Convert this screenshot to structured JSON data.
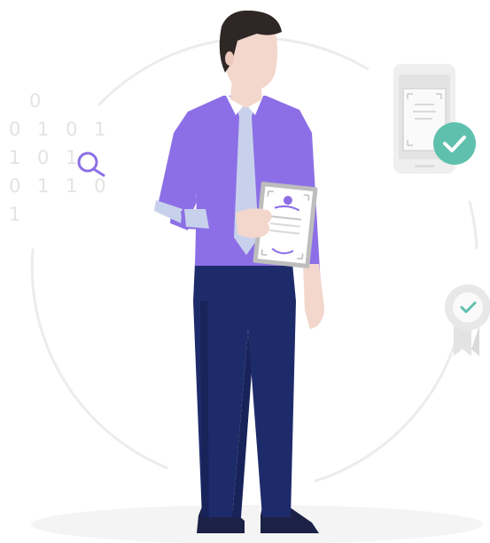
{
  "illustration": {
    "binary_rows": [
      "0",
      "0 1 0 1",
      "1 0 1",
      "0 1 1 0",
      "1"
    ],
    "icons": {
      "magnifier": "search-icon",
      "phone": "phone-document-icon",
      "check_badge": "check-circle-icon",
      "award": "award-ribbon-icon",
      "certificate": "certificate-icon"
    },
    "colors": {
      "shirt": "#8c6fe6",
      "shirt_shadow": "#7c5fd6",
      "tie": "#c8d1ec",
      "skin": "#f3d6cc",
      "hair": "#2f2626",
      "pants": "#1e2b6b",
      "pants_dark": "#18235a",
      "shoes": "#1c2146",
      "certificate_frame": "#bdbdbd",
      "certificate_accent": "#8c6fe6",
      "check_green": "#5fc1ad",
      "magnifier": "#8c6fe6",
      "ring": "#ececec",
      "phone": "#e9e9e9",
      "ground": "#f4f4f4",
      "binary": "#e3e3e3"
    }
  }
}
